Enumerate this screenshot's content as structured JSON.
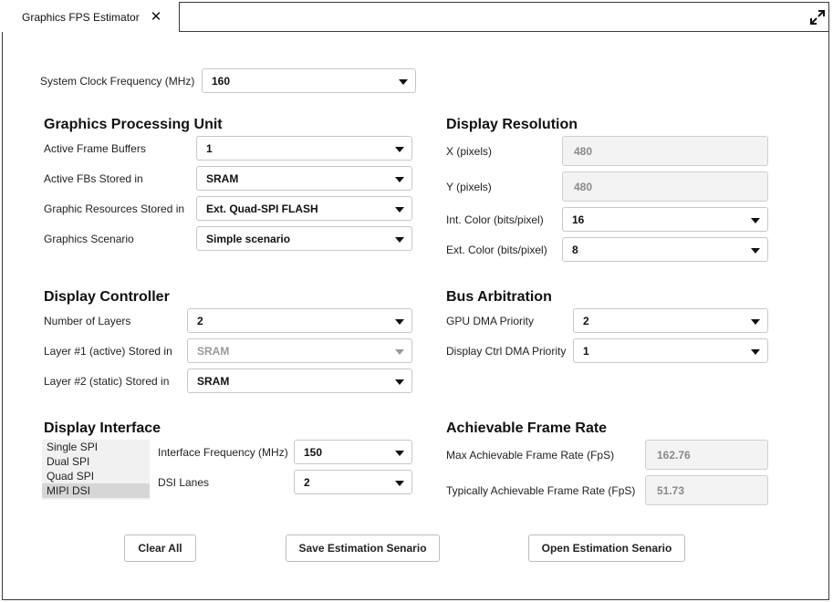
{
  "window": {
    "tab_title": "Graphics FPS Estimator",
    "close_glyph": "✕"
  },
  "system": {
    "clock_label": "System Clock Frequency (MHz)",
    "clock_value": "160"
  },
  "gpu": {
    "heading": "Graphics Processing Unit",
    "frame_buffers_label": "Active Frame Buffers",
    "frame_buffers_value": "1",
    "fbs_stored_label": "Active FBs Stored in",
    "fbs_stored_value": "SRAM",
    "resources_label": "Graphic Resources Stored in",
    "resources_value": "Ext. Quad-SPI FLASH",
    "scenario_label": "Graphics Scenario",
    "scenario_value": "Simple scenario"
  },
  "resolution": {
    "heading": "Display Resolution",
    "x_label": "X (pixels)",
    "x_value": "480",
    "y_label": "Y (pixels)",
    "y_value": "480",
    "int_color_label": "Int. Color (bits/pixel)",
    "int_color_value": "16",
    "ext_color_label": "Ext. Color (bits/pixel)",
    "ext_color_value": "8"
  },
  "controller": {
    "heading": "Display Controller",
    "layers_label": "Number of Layers",
    "layers_value": "2",
    "layer1_label": "Layer #1 (active) Stored in",
    "layer1_value": "SRAM",
    "layer2_label": "Layer #2 (static) Stored in",
    "layer2_value": "SRAM"
  },
  "bus": {
    "heading": "Bus Arbitration",
    "gpu_dma_label": "GPU DMA Priority",
    "gpu_dma_value": "2",
    "ctrl_dma_label": "Display Ctrl DMA Priority",
    "ctrl_dma_value": "1"
  },
  "interface": {
    "heading": "Display Interface",
    "options": [
      "Single SPI",
      "Dual SPI",
      "Quad SPI",
      "MIPI DSI"
    ],
    "selected": "MIPI DSI",
    "freq_label": "Interface Frequency (MHz)",
    "freq_value": "150",
    "lanes_label": "DSI Lanes",
    "lanes_value": "2"
  },
  "framerate": {
    "heading": "Achievable Frame Rate",
    "max_label": "Max Achievable Frame Rate (FpS)",
    "max_value": "162.76",
    "typ_label": "Typically Achievable Frame Rate (FpS)",
    "typ_value": "51.73"
  },
  "buttons": {
    "clear": "Clear All",
    "save": "Save Estimation Senario",
    "open": "Open Estimation Senario"
  },
  "colors": {
    "border": "#3a3a3a",
    "field_border": "#c7c7c7",
    "readonly_bg": "#f3f3f3",
    "list_bg": "#f1f1f1",
    "list_selected_bg": "#d6d6d6",
    "disabled_text": "#9a9a9a"
  },
  "icons": {
    "maximize": "expand-arrows-icon",
    "close": "close-icon",
    "dropdown": "chevron-down-icon"
  }
}
